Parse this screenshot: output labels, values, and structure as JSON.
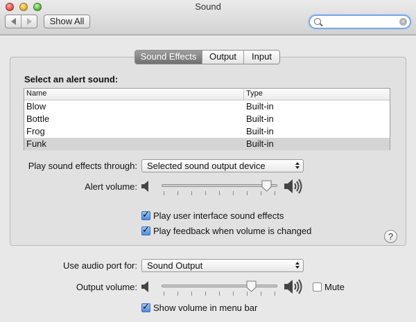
{
  "window": {
    "title": "Sound"
  },
  "toolbar": {
    "show_all_label": "Show All",
    "search_placeholder": ""
  },
  "tabs": [
    {
      "label": "Sound Effects",
      "active": true
    },
    {
      "label": "Output",
      "active": false
    },
    {
      "label": "Input",
      "active": false
    }
  ],
  "alerts": {
    "heading": "Select an alert sound:",
    "columns": [
      "Name",
      "Type"
    ],
    "rows": [
      {
        "name": "Blow",
        "type": "Built-in"
      },
      {
        "name": "Bottle",
        "type": "Built-in"
      },
      {
        "name": "Frog",
        "type": "Built-in"
      },
      {
        "name": "Funk",
        "type": "Built-in",
        "selected": true
      }
    ]
  },
  "effects": {
    "play_through_label": "Play sound effects through:",
    "play_through_value": "Selected sound output device",
    "alert_volume_label": "Alert volume:",
    "alert_volume_level": 0.95,
    "ui_sounds_label": "Play user interface sound effects",
    "ui_sounds_checked": true,
    "feedback_label": "Play feedback when volume is changed",
    "feedback_checked": true,
    "help_label": "?"
  },
  "output": {
    "audio_port_label": "Use audio port for:",
    "audio_port_value": "Sound Output",
    "output_volume_label": "Output volume:",
    "output_volume_level": 0.8,
    "mute_label": "Mute",
    "mute_checked": false,
    "show_menu_label": "Show volume in menu bar",
    "show_menu_checked": true
  },
  "colors": {
    "accent": "#4b8de0",
    "selected_row": "#d4d4d4"
  },
  "icons": [
    "back-arrow-icon",
    "forward-arrow-icon",
    "search-icon",
    "clear-icon",
    "speaker-low-icon",
    "speaker-high-icon",
    "help-icon"
  ]
}
